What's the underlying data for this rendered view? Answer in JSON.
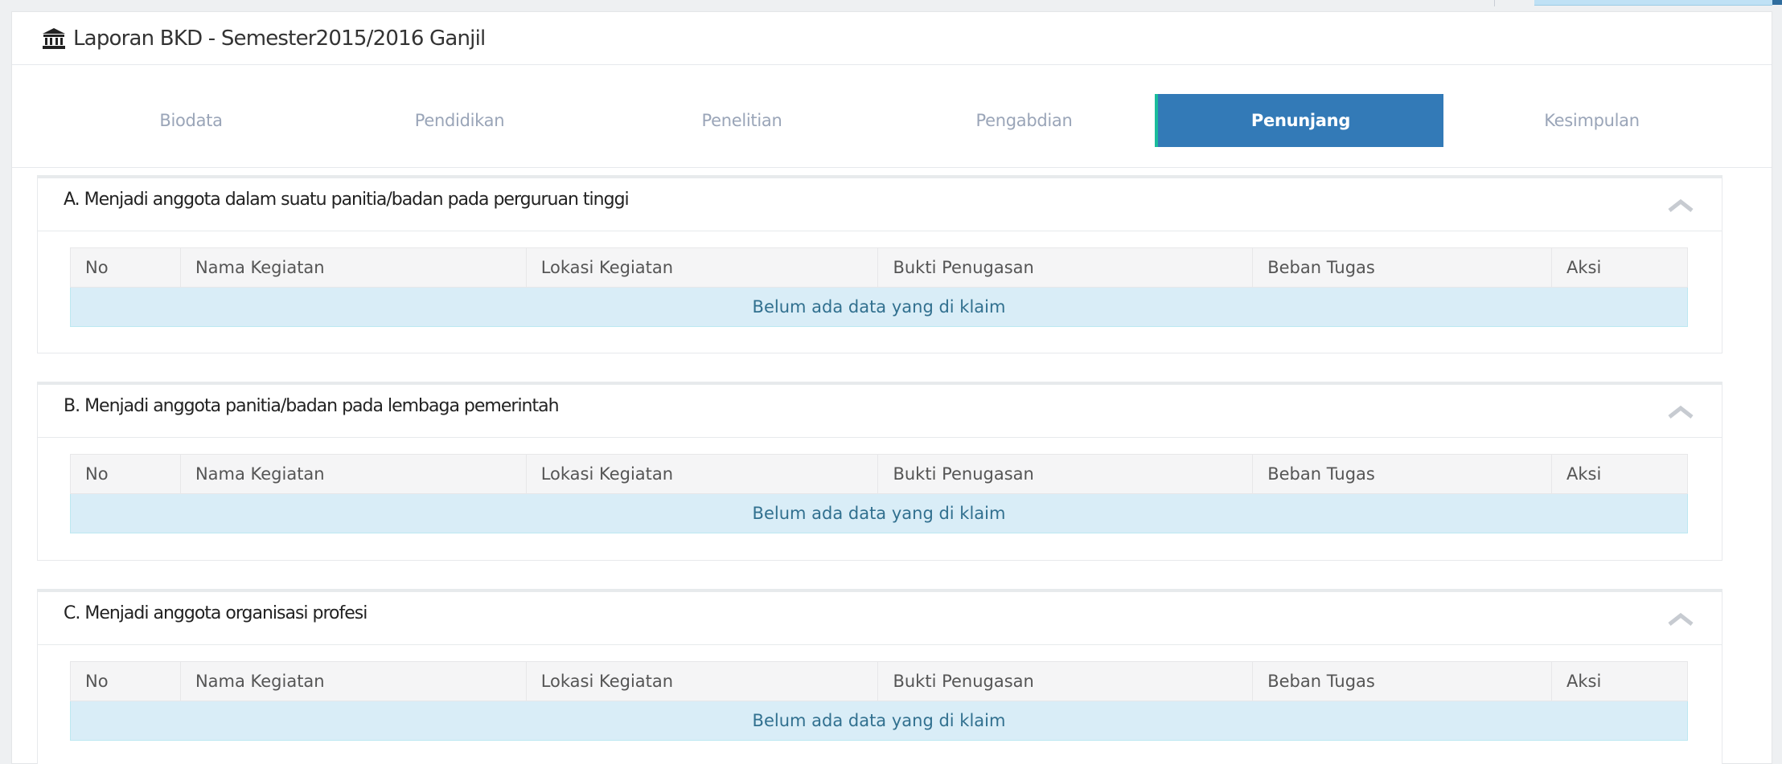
{
  "page": {
    "title": "Laporan BKD - Semester2015/2016 Ganjil",
    "icon": "institution-icon"
  },
  "tabs": [
    {
      "label": "Biodata",
      "active": false
    },
    {
      "label": "Pendidikan",
      "active": false
    },
    {
      "label": "Penelitian",
      "active": false
    },
    {
      "label": "Pengabdian",
      "active": false
    },
    {
      "label": "Penunjang",
      "active": true
    },
    {
      "label": "Kesimpulan",
      "active": false
    }
  ],
  "table_columns": [
    "No",
    "Nama Kegiatan",
    "Lokasi Kegiatan",
    "Bukti Penugasan",
    "Beban Tugas",
    "Aksi"
  ],
  "sections": [
    {
      "title": "A. Menjadi anggota dalam suatu panitia/badan pada perguruan tinggi",
      "empty_message": "Belum ada data yang di klaim"
    },
    {
      "title": "B. Menjadi anggota panitia/badan pada lembaga pemerintah",
      "empty_message": "Belum ada data yang di klaim"
    },
    {
      "title": "C. Menjadi anggota organisasi profesi",
      "empty_message": "Belum ada data yang di klaim"
    }
  ],
  "colors": {
    "active_tab": "#337ab7",
    "tab_accent": "#1abc9c",
    "info_row": "#d9edf7",
    "info_text": "#31708f"
  }
}
